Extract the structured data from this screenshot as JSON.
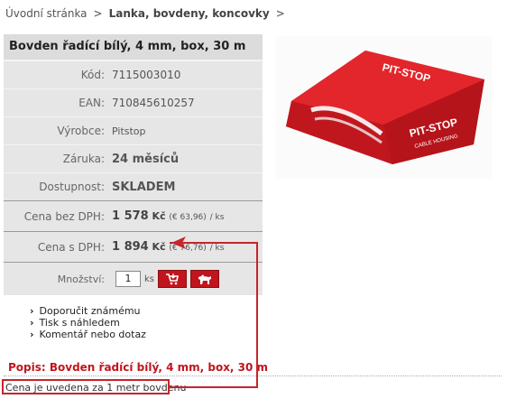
{
  "breadcrumb": {
    "home": "Úvodní stránka",
    "category": "Lanka, bovdeny, koncovky"
  },
  "product": {
    "title": "Bovden řadící bílý, 4 mm, box, 30 m",
    "rows": {
      "kod": {
        "label": "Kód:",
        "value": "7115003010"
      },
      "ean": {
        "label": "EAN:",
        "value": "710845610257"
      },
      "vyrobce": {
        "label": "Výrobce:",
        "value": "Pitstop"
      },
      "zaruka": {
        "label": "Záruka:",
        "value": "24 měsíců"
      },
      "dostupnost": {
        "label": "Dostupnost:",
        "value": "SKLADEM"
      },
      "cena_bez": {
        "label": "Cena bez DPH:",
        "value": "1 578",
        "currency": "Kč",
        "euro": "(€ 63,96)",
        "unit": "/ ks"
      },
      "cena_s": {
        "label": "Cena s DPH:",
        "value": "1 894",
        "currency": "Kč",
        "euro": "(€ 76,76)",
        "unit": "/ ks"
      },
      "mnozstvi": {
        "label": "Množství:",
        "value": "1",
        "unit": "ks"
      }
    },
    "image_brand": "PIT-STOP",
    "image_sublabel": "CABLE HOUSING"
  },
  "links": [
    "Doporučit známému",
    "Tisk s náhledem",
    "Komentář nebo dotaz"
  ],
  "popis": "Popis: Bovden řadící bílý, 4 mm, box, 30 m",
  "note": "Cena je uvedena za 1 metr bovdenu",
  "colors": {
    "accent": "#c0151d",
    "in_stock": "#16a016",
    "annotation": "#c6252b"
  },
  "icons": [
    "cart-icon",
    "dog-icon",
    "chevron-right-icon"
  ]
}
